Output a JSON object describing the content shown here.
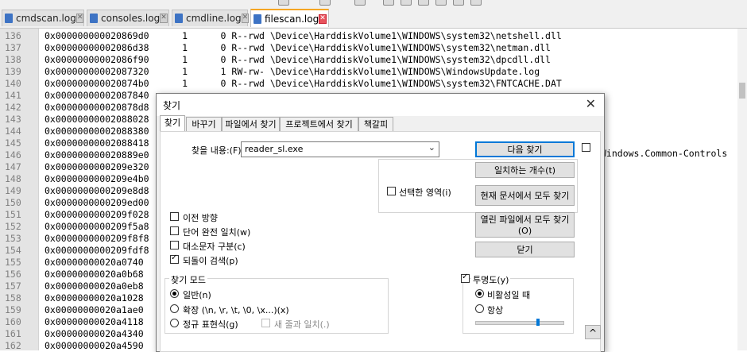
{
  "tabs": [
    {
      "label": "cmdscan.log",
      "active": false
    },
    {
      "label": "consoles.log",
      "active": false
    },
    {
      "label": "cmdline.log",
      "active": false
    },
    {
      "label": "filescan.log",
      "active": true
    }
  ],
  "editor": {
    "lines": [
      {
        "num": "136",
        "text": "0x000000000020869d0      1      0 R--rwd \\Device\\HarddiskVolume1\\WINDOWS\\system32\\netshell.dll"
      },
      {
        "num": "137",
        "text": "0x00000000002086d38      1      0 R--rwd \\Device\\HarddiskVolume1\\WINDOWS\\system32\\netman.dll"
      },
      {
        "num": "138",
        "text": "0x00000000002086f90      1      0 R--rwd \\Device\\HarddiskVolume1\\WINDOWS\\system32\\dpcdll.dll"
      },
      {
        "num": "139",
        "text": "0x00000000002087320      1      1 RW-rw- \\Device\\HarddiskVolume1\\WINDOWS\\WindowsUpdate.log"
      },
      {
        "num": "140",
        "text": "0x000000000020874b0      1      0 R--rwd \\Device\\HarddiskVolume1\\WINDOWS\\system32\\FNTCACHE.DAT"
      },
      {
        "num": "141",
        "text": "0x00000000002087840"
      },
      {
        "num": "142",
        "text": "0x000000000020878d8"
      },
      {
        "num": "143",
        "text": "0x00000000002088028"
      },
      {
        "num": "144",
        "text": "0x00000000002088380"
      },
      {
        "num": "145",
        "text": "0x00000000002088418"
      },
      {
        "num": "146",
        "text": "0x000000000020889e0"
      },
      {
        "num": "147",
        "text": "0x0000000000209e320"
      },
      {
        "num": "148",
        "text": "0x0000000000209e4b0"
      },
      {
        "num": "149",
        "text": "0x0000000000209e8d8"
      },
      {
        "num": "150",
        "text": "0x0000000000209ed00"
      },
      {
        "num": "151",
        "text": "0x0000000000209f028"
      },
      {
        "num": "152",
        "text": "0x0000000000209f5a8"
      },
      {
        "num": "153",
        "text": "0x0000000000209f8f8"
      },
      {
        "num": "154",
        "text": "0x0000000000209fdf8"
      },
      {
        "num": "155",
        "text": "0x00000000020a0740"
      },
      {
        "num": "156",
        "text": "0x00000000020a0b68"
      },
      {
        "num": "157",
        "text": "0x00000000020a0eb8"
      },
      {
        "num": "158",
        "text": "0x00000000020a1028"
      },
      {
        "num": "159",
        "text": "0x00000000020a1ae0"
      },
      {
        "num": "160",
        "text": "0x00000000020a4118"
      },
      {
        "num": "161",
        "text": "0x00000000020a4340"
      },
      {
        "num": "162",
        "text": "0x00000000020a4590"
      }
    ],
    "overflow_text_line_146": "Windows.Common-Controls"
  },
  "dialog": {
    "title": "찾기",
    "close_glyph": "✕",
    "tabs": [
      "찾기",
      "바꾸기",
      "파일에서 찾기",
      "프로젝트에서 찾기",
      "책갈피"
    ],
    "find_label": "찾을 내용:(F)",
    "find_value": "reader_sl.exe",
    "dropdown_glyph": "⌄",
    "buttons": {
      "find_next": "다음 찾기",
      "count": "일치하는 개수(t)",
      "find_all_current": "현재 문서에서 모두 찾기",
      "find_all_open_line1": "열린 파일에서 모두 찾기",
      "find_all_open_line2": "(O)",
      "close": "닫기",
      "collapse": "^"
    },
    "in_selection": "선택한 영역(i)",
    "options": {
      "backward": "이전 방향",
      "whole_word": "단어 완전 일치(w)",
      "match_case": "대소문자 구분(c)",
      "wrap": "되돌이 검색(p)"
    },
    "search_mode": {
      "title": "찾기 모드",
      "normal": "일반(n)",
      "extended": "확장 (\\n, \\r, \\t, \\0, \\x...)(x)",
      "regex": "정규 표현식(g)",
      "dot_newline": "새 줄과 일치(.)"
    },
    "transparency": {
      "title": "투명도(y)",
      "on_lose_focus": "비활성일 때",
      "always": "항상"
    }
  }
}
